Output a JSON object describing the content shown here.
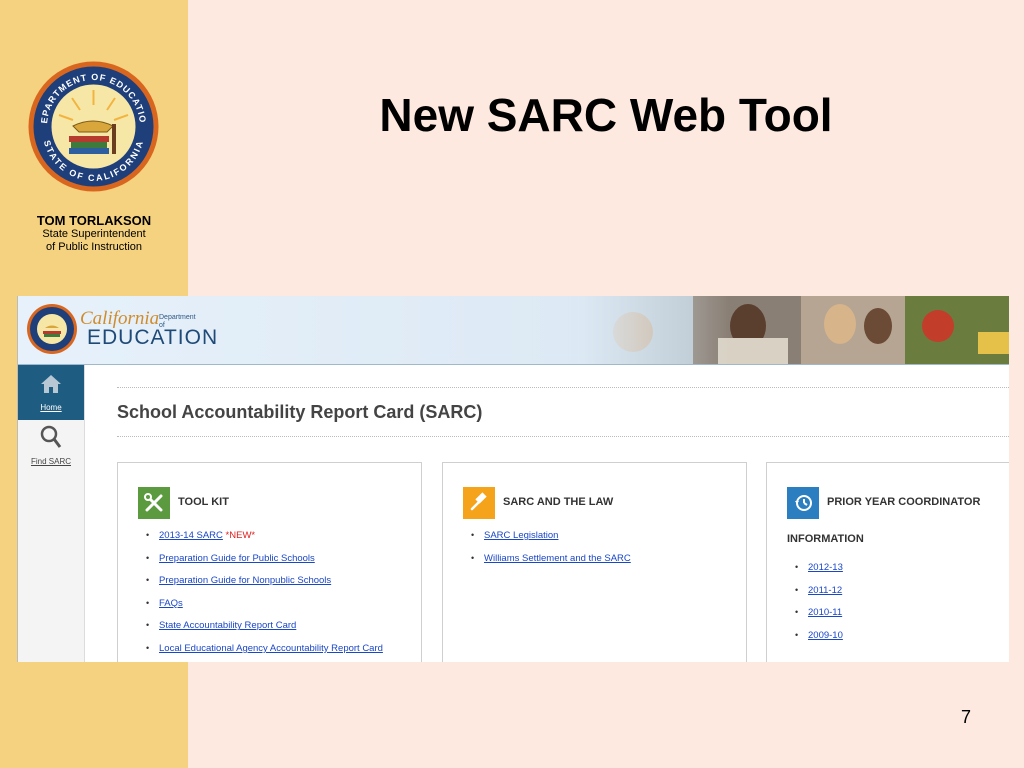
{
  "slide": {
    "title": "New SARC Web Tool",
    "page_number": "7"
  },
  "official": {
    "name": "TOM TORLAKSON",
    "title_line1": "State Superintendent",
    "title_line2": "of Public Instruction"
  },
  "seal": {
    "top_text": "DEPARTMENT OF EDUCATION",
    "bottom_text": "STATE OF CALIFORNIA"
  },
  "screenshot": {
    "header": {
      "wordmark_california": "California",
      "wordmark_dept": "Department of",
      "wordmark_education": "EDUCATION"
    },
    "nav": [
      {
        "label": "Home",
        "icon": "home-icon"
      },
      {
        "label": "Find SARC",
        "icon": "search-icon"
      }
    ],
    "page_heading": "School Accountability Report Card (SARC)",
    "cards": [
      {
        "title": "TOOL KIT",
        "icon": "tools-icon",
        "color": "#5b9a3e",
        "links": [
          {
            "label": "2013-14 SARC",
            "tag": "*NEW*"
          },
          {
            "label": "Preparation Guide for Public Schools"
          },
          {
            "label": "Preparation Guide for Nonpublic Schools"
          },
          {
            "label": "FAQs"
          },
          {
            "label": "State Accountability Report Card"
          },
          {
            "label": "Local Educational Agency Accountability Report Card"
          }
        ]
      },
      {
        "title": "SARC AND THE LAW",
        "icon": "gavel-icon",
        "color": "#f5a31a",
        "links": [
          {
            "label": "SARC Legislation"
          },
          {
            "label": "Williams Settlement and the SARC"
          }
        ]
      },
      {
        "title": "PRIOR YEAR COORDINATOR",
        "subtitle": "INFORMATION",
        "icon": "history-icon",
        "color": "#2b7fc0",
        "links": [
          {
            "label": "2012-13"
          },
          {
            "label": "2011-12"
          },
          {
            "label": "2010-11"
          },
          {
            "label": "2009-10"
          }
        ]
      }
    ]
  }
}
